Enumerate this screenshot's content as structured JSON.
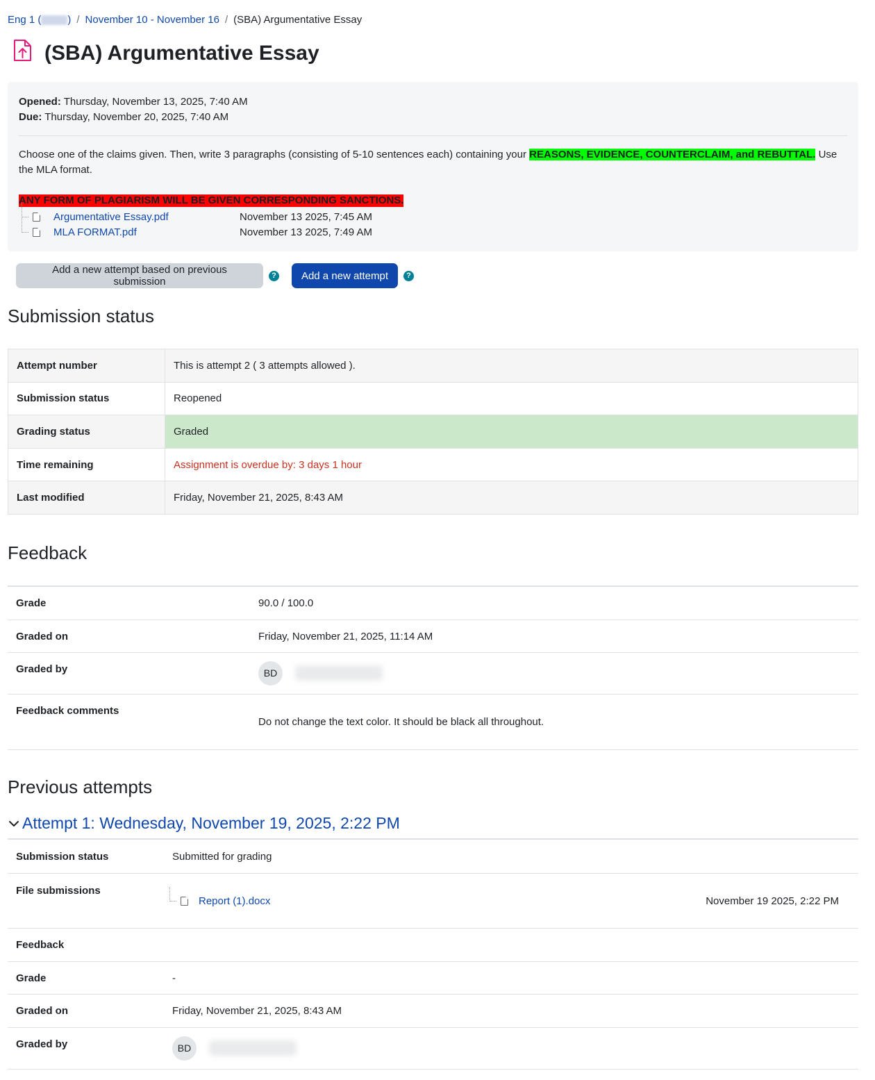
{
  "breadcrumb": {
    "course_prefix": "Eng 1 (",
    "course_suffix": ")",
    "week": "November 10 - November 16",
    "current": "(SBA) Argumentative Essay",
    "separator": "/"
  },
  "page": {
    "title": "(SBA) Argumentative Essay",
    "icon": "assignment-upload-icon",
    "icon_color": "#e6197d"
  },
  "dates": {
    "opened_label": "Opened:",
    "opened_value": "Thursday, November 13, 2025, 7:40 AM",
    "due_label": "Due:",
    "due_value": "Thursday, November 20, 2025, 7:40 AM"
  },
  "intro": {
    "before": "Choose one of the claims given. Then, write 3 paragraphs (consisting of 5-10 sentences each) containing your ",
    "highlight": "REASONS, EVIDENCE, COUNTERCLAIM, and REBUTTAL.",
    "after": " Use the MLA format.",
    "warning": "ANY FORM OF PLAGIARISM WILL BE GIVEN CORRESPONDING SANCTIONS.",
    "highlight_color": "#00ff00",
    "warning_color": "#ff0000"
  },
  "files": [
    {
      "name": "Argumentative Essay.pdf",
      "date": "November 13 2025, 7:45 AM",
      "icon": "pdf-file-icon"
    },
    {
      "name": "MLA FORMAT.pdf",
      "date": "November 13 2025, 7:49 AM",
      "icon": "pdf-file-icon"
    }
  ],
  "actions": {
    "add_previous": "Add a new attempt based on previous submission",
    "add_new": "Add a new attempt",
    "help_glyph": "?"
  },
  "submission_status": {
    "heading": "Submission status",
    "rows": [
      {
        "label": "Attempt number",
        "value": "This is attempt 2 ( 3 attempts allowed )."
      },
      {
        "label": "Submission status",
        "value": "Reopened"
      },
      {
        "label": "Grading status",
        "value": "Graded"
      },
      {
        "label": "Time remaining",
        "value": "Assignment is overdue by: 3 days 1 hour"
      },
      {
        "label": "Last modified",
        "value": "Friday, November 21, 2025, 8:43 AM"
      }
    ]
  },
  "feedback": {
    "heading": "Feedback",
    "grade_label": "Grade",
    "grade_value": "90.0 / 100.0",
    "graded_on_label": "Graded on",
    "graded_on_value": "Friday, November 21, 2025, 11:14 AM",
    "graded_by_label": "Graded by",
    "grader_initials": "BD",
    "comments_label": "Feedback comments",
    "comments_value": "Do not change the text color. It should be black all throughout."
  },
  "previous_attempts": {
    "heading": "Previous attempts",
    "attempt_title": "Attempt 1: Wednesday, November 19, 2025, 2:22 PM",
    "submission_status_label": "Submission status",
    "submission_status_value": "Submitted for grading",
    "file_submissions_label": "File submissions",
    "file_name": "Report (1).docx",
    "file_date": "November 19 2025, 2:22 PM",
    "feedback_label": "Feedback",
    "grade_label": "Grade",
    "grade_value": "-",
    "graded_on_label": "Graded on",
    "graded_on_value": "Friday, November 21, 2025, 8:43 AM",
    "graded_by_label": "Graded by",
    "grader_initials": "BD"
  }
}
